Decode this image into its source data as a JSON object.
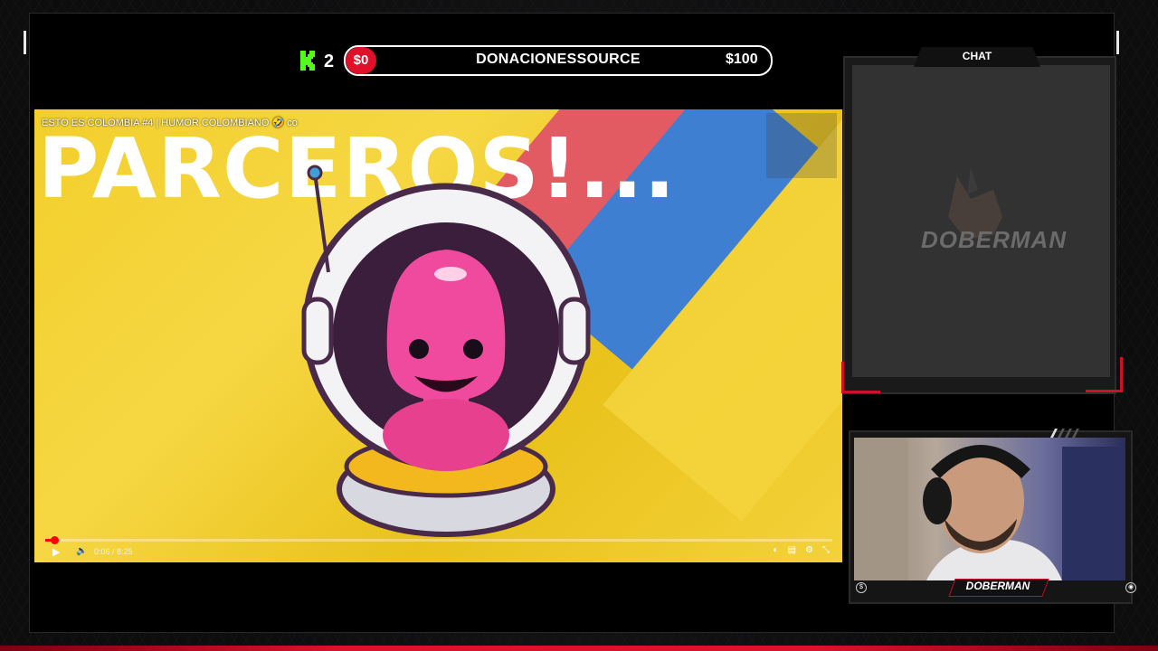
{
  "donation_bar": {
    "kick_icon": "kick-logo-icon",
    "count": "2",
    "amount": "$0",
    "name": "DONACIONESSOURCE",
    "goal": "$100"
  },
  "video": {
    "title": "ESTO ES COLOMBIA #4 | HUMOR COLOMBIANO 🤣 co",
    "headline": "PARCEROS!...",
    "time": "0:06 / 8:25",
    "progress_fraction": 0.012,
    "controls": [
      "play-icon",
      "volume-icon",
      "autoplay-toggle-icon",
      "subtitles-icon",
      "settings-icon",
      "fullscreen-exit-icon"
    ]
  },
  "chat": {
    "label": "CHAT",
    "logo_text": "DOBERMAN"
  },
  "cam": {
    "name": "DOBERMAN"
  },
  "colors": {
    "accent_red": "#e0102a",
    "kick_green": "#53fc18",
    "video_yellow": "#f2cf2b"
  }
}
